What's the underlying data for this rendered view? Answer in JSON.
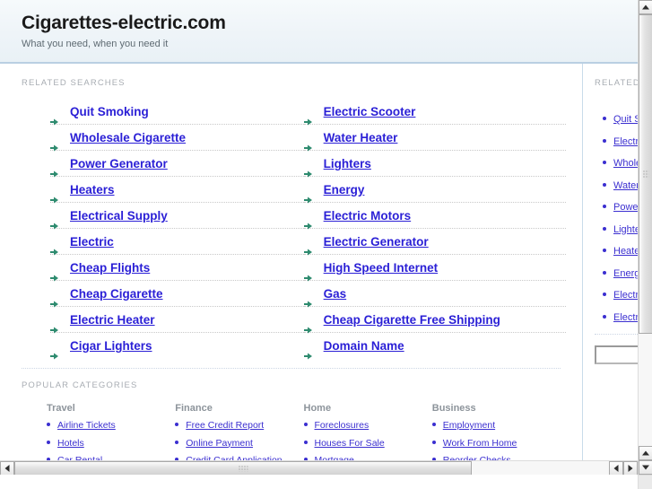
{
  "header": {
    "title": "Cigarettes-electric.com",
    "tagline": "What you need, when you need it"
  },
  "main": {
    "related_label": "RELATED SEARCHES",
    "related_left": [
      "Quit Smoking",
      "Wholesale Cigarette",
      "Power Generator",
      "Heaters",
      "Electrical Supply",
      "Electric",
      "Cheap Flights",
      "Cheap Cigarette",
      "Electric Heater",
      "Cigar Lighters"
    ],
    "related_right": [
      "Electric Scooter",
      "Water Heater",
      "Lighters",
      "Energy",
      "Electric Motors",
      "Electric Generator",
      "High Speed Internet",
      "Gas",
      "Cheap Cigarette Free Shipping",
      "Domain Name"
    ],
    "popular_label": "POPULAR CATEGORIES",
    "categories": [
      {
        "heading": "Travel",
        "items": [
          "Airline Tickets",
          "Hotels",
          "Car Rental"
        ]
      },
      {
        "heading": "Finance",
        "items": [
          "Free Credit Report",
          "Online Payment",
          "Credit Card Application"
        ]
      },
      {
        "heading": "Home",
        "items": [
          "Foreclosures",
          "Houses For Sale",
          "Mortgage"
        ]
      },
      {
        "heading": "Business",
        "items": [
          "Employment",
          "Work From Home",
          "Reorder Checks"
        ]
      }
    ]
  },
  "sidebar": {
    "label": "RELATED SEARCHES",
    "items": [
      "Quit Smoking",
      "Electric Scooter",
      "Wholesale Cigarette",
      "Water Heater",
      "Power Generator",
      "Lighters",
      "Heaters",
      "Energy",
      "Electrical Supply",
      "Electric Motors"
    ],
    "search_value": "",
    "search_placeholder": ""
  },
  "colors": {
    "link": "#2a1fd6",
    "sidebar_link": "#3b2fd0",
    "arrow_bullet": "#2e8b6f",
    "header_bg": "#eef4f8",
    "header_rule": "#b9cfe2",
    "label_text": "#a8adb3"
  },
  "scrollbars": {
    "vertical_up": "scroll-up-arrow",
    "vertical_down": "scroll-down-arrow",
    "horizontal_left": "scroll-left-arrow",
    "horizontal_right": "scroll-right-arrow"
  }
}
